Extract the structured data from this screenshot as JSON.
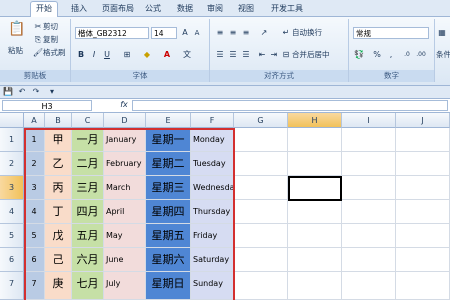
{
  "ribbon_tabs": [
    {
      "label": "开始",
      "active": true
    },
    {
      "label": "插入",
      "active": false
    },
    {
      "label": "页面布局",
      "active": false
    },
    {
      "label": "公式",
      "active": false
    },
    {
      "label": "数据",
      "active": false
    },
    {
      "label": "审阅",
      "active": false
    },
    {
      "label": "视图",
      "active": false
    },
    {
      "label": "开发工具",
      "active": false
    }
  ],
  "clipboard": {
    "paste": "粘贴",
    "cut": "剪切",
    "copy": "复制",
    "format_painter": "格式刷",
    "label": "剪贴板"
  },
  "font": {
    "name": "楷体_GB2312",
    "size": "14",
    "label": "字体",
    "bold": "B",
    "italic": "I",
    "underline": "U",
    "font_color": "A"
  },
  "alignment": {
    "wrap": "自动换行",
    "merge": "合并后居中",
    "label": "对齐方式"
  },
  "number": {
    "format": "常规",
    "percent": "%",
    "comma": ",",
    "label": "数字"
  },
  "styles": {
    "conditional": "条件"
  },
  "formula_bar": {
    "name_box": "H3",
    "fx": "fx",
    "value": ""
  },
  "colors": {
    "col_b": "#f9dcc9",
    "col_c": "#c6e0a6",
    "col_d": "#f2dcdb",
    "col_e": "#4f86d4",
    "col_f": "#d6dcf2",
    "border": "#d32f2f"
  },
  "columns": [
    "A",
    "B",
    "C",
    "D",
    "E",
    "F",
    "G",
    "H",
    "I",
    "J"
  ],
  "rows": [
    {
      "num": "1",
      "a": "1",
      "b": "甲",
      "c": "一月",
      "d": "January",
      "e": "星期一",
      "f": "Monday"
    },
    {
      "num": "2",
      "a": "2",
      "b": "乙",
      "c": "二月",
      "d": "February",
      "e": "星期二",
      "f": "Tuesday"
    },
    {
      "num": "3",
      "a": "3",
      "b": "丙",
      "c": "三月",
      "d": "March",
      "e": "星期三",
      "f": "Wednesday"
    },
    {
      "num": "4",
      "a": "4",
      "b": "丁",
      "c": "四月",
      "d": "April",
      "e": "星期四",
      "f": "Thursday"
    },
    {
      "num": "5",
      "a": "5",
      "b": "戊",
      "c": "五月",
      "d": "May",
      "e": "星期五",
      "f": "Friday"
    },
    {
      "num": "6",
      "a": "6",
      "b": "己",
      "c": "六月",
      "d": "June",
      "e": "星期六",
      "f": "Saturday"
    },
    {
      "num": "7",
      "a": "7",
      "b": "庚",
      "c": "七月",
      "d": "July",
      "e": "星期日",
      "f": "Sunday"
    }
  ]
}
